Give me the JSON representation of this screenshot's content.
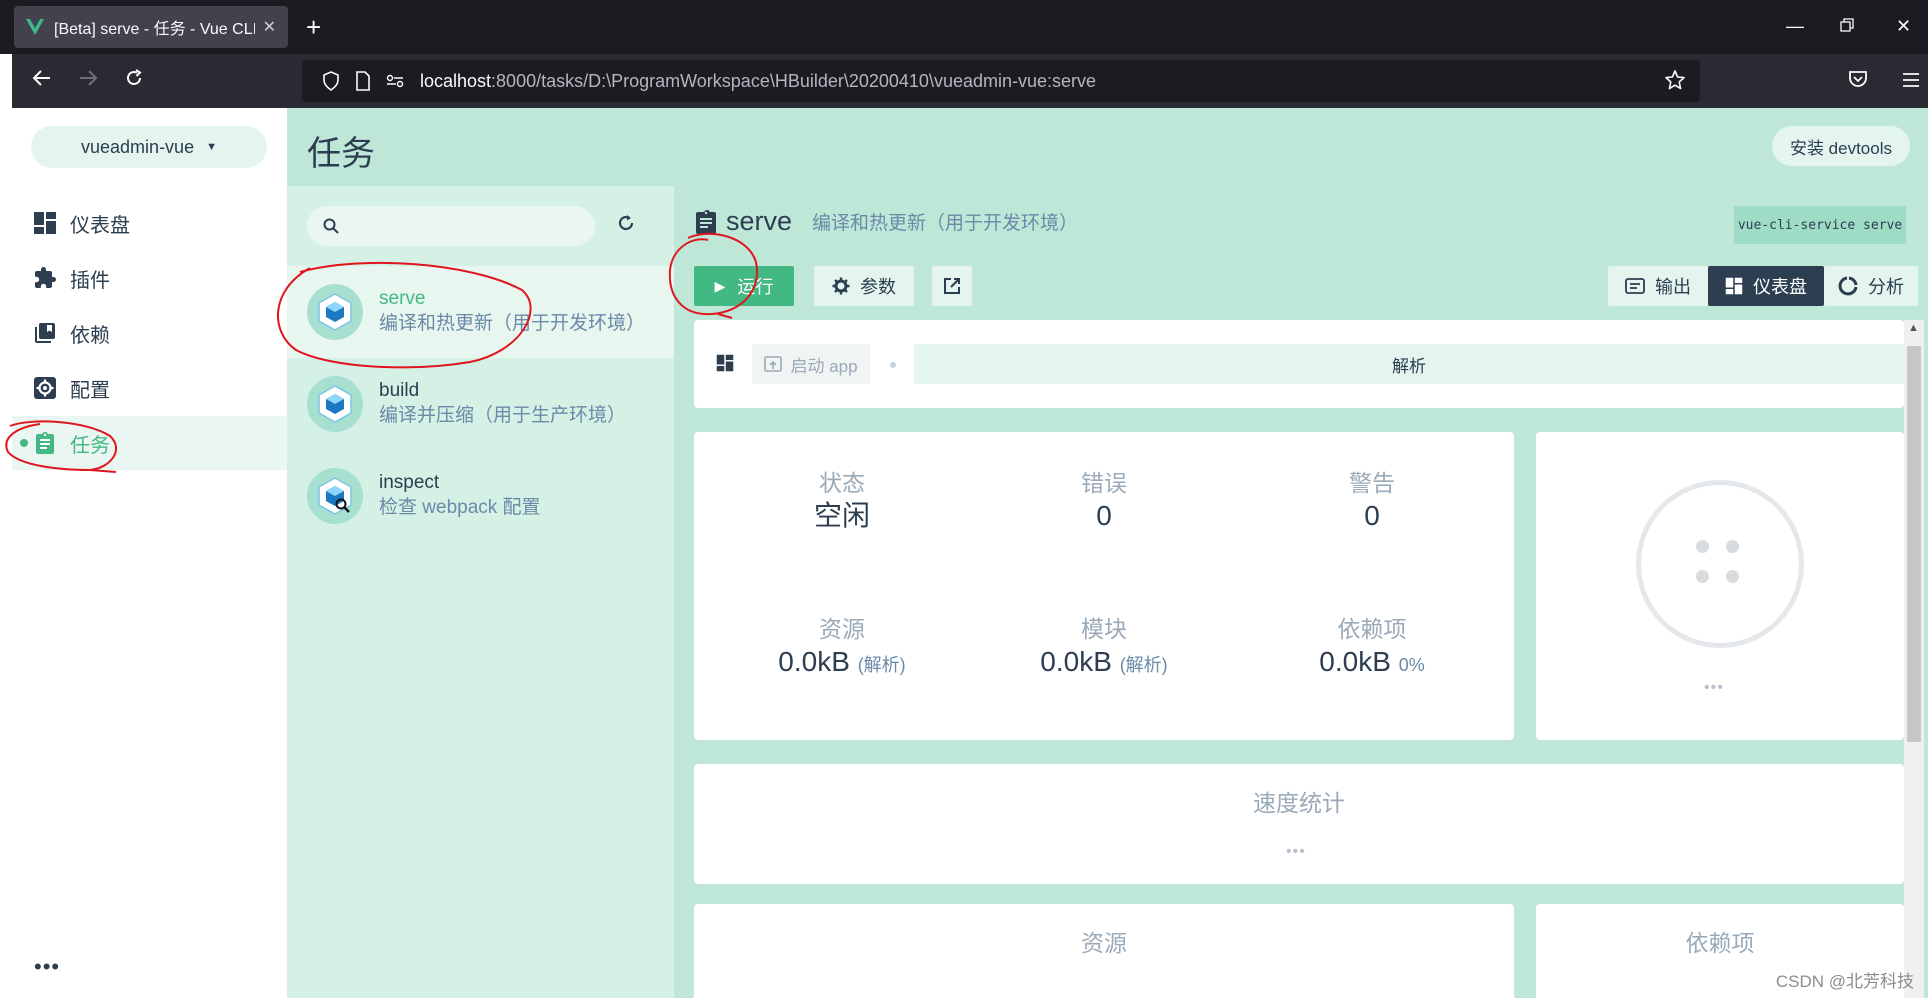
{
  "browser": {
    "tab_title": "[Beta] serve - 任务 - Vue CLI",
    "url_host": "localhost",
    "url_path": ":8000/tasks/D:\\ProgramWorkspace\\HBuilder\\20200410\\vueadmin-vue:serve"
  },
  "sidebar": {
    "project": "vueadmin-vue",
    "items": [
      {
        "label": "仪表盘",
        "icon": "dashboard-icon"
      },
      {
        "label": "插件",
        "icon": "puzzle-icon"
      },
      {
        "label": "依赖",
        "icon": "library-icon"
      },
      {
        "label": "配置",
        "icon": "settings-icon"
      },
      {
        "label": "任务",
        "icon": "assignment-icon",
        "active": true
      }
    ],
    "more": "•••"
  },
  "header": {
    "title": "任务",
    "devtools_label": "安装 devtools"
  },
  "search": {
    "placeholder": ""
  },
  "tasks": [
    {
      "name": "serve",
      "desc": "编译和热更新（用于开发环境）",
      "selected": true
    },
    {
      "name": "build",
      "desc": "编译并压缩（用于生产环境）"
    },
    {
      "name": "inspect",
      "desc": "检查 webpack 配置"
    }
  ],
  "detail": {
    "name": "serve",
    "desc": "编译和热更新（用于开发环境）",
    "command": "vue-cli-service serve",
    "run_label": "运行",
    "params_label": "参数",
    "output_label": "输出",
    "dashboard_label": "仪表盘",
    "analyze_label": "分析",
    "start_app_label": "启动 app",
    "analyze_tab_label": "解析",
    "stats": {
      "status_label": "状态",
      "status_value": "空闲",
      "errors_label": "错误",
      "errors_value": "0",
      "warnings_label": "警告",
      "warnings_value": "0",
      "assets_label": "资源",
      "assets_value": "0.0kB",
      "assets_sub": "(解析)",
      "modules_label": "模块",
      "modules_value": "0.0kB",
      "modules_sub": "(解析)",
      "deps_label": "依赖项",
      "deps_value": "0.0kB",
      "deps_sub": "0%"
    },
    "status_dots": "•••",
    "speed_title": "速度统计",
    "speed_dots": "•••",
    "assets_title": "资源",
    "deps_title": "依赖项"
  },
  "watermark": "CSDN @北芳科技",
  "colors": {
    "accent": "#42b983",
    "dark": "#2c3e50",
    "header_bg": "#bfe7d8",
    "annotation": "#e0161f"
  }
}
